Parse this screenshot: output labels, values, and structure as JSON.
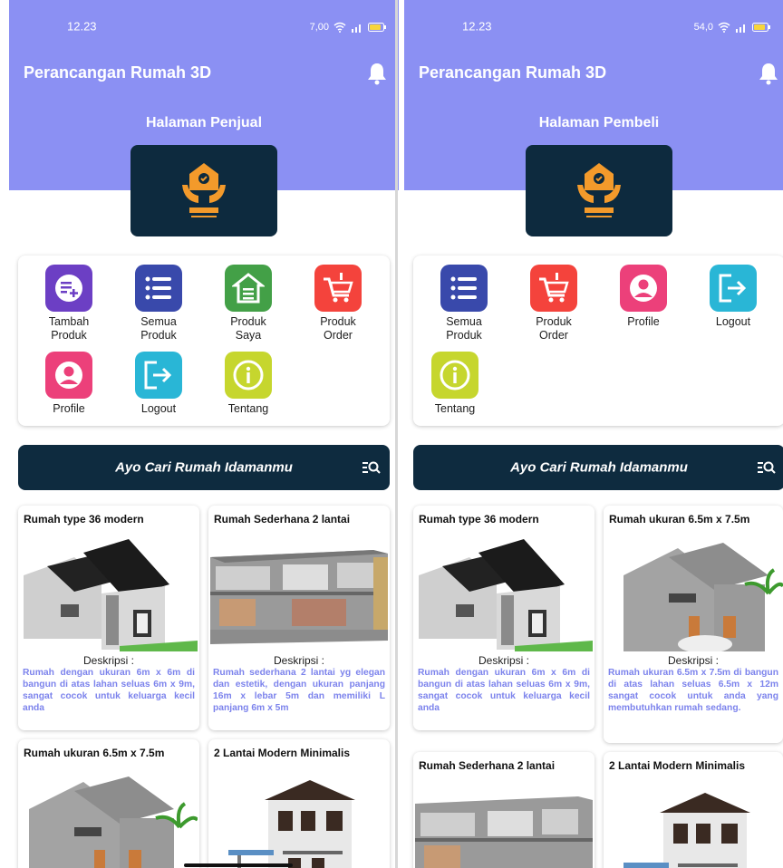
{
  "colors": {
    "header": "#8b90f3",
    "navy": "#0e2b3f",
    "desc_text": "#7c83ec",
    "icon_tambah": "#6c3fc4",
    "icon_semua": "#3949ab",
    "icon_produk_saya": "#43a047",
    "icon_order": "#f4433c",
    "icon_profile": "#ec407a",
    "icon_logout": "#29b6d6",
    "icon_tentang": "#c6d62e"
  },
  "left": {
    "status": {
      "time": "12.23",
      "speed": "7,00"
    },
    "app_title": "Perancangan Rumah 3D",
    "page_title": "Halaman Penjual",
    "menu": [
      {
        "label": "Tambah\nProduk",
        "icon": "add-product-icon"
      },
      {
        "label": "Semua\nProduk",
        "icon": "list-icon"
      },
      {
        "label": "Produk\nSaya",
        "icon": "house-icon"
      },
      {
        "label": "Produk\nOrder",
        "icon": "cart-icon"
      },
      {
        "label": "Profile",
        "icon": "profile-icon"
      },
      {
        "label": "Logout",
        "icon": "logout-icon"
      },
      {
        "label": "Tentang",
        "icon": "info-icon"
      }
    ],
    "search_label": "Ayo Cari Rumah Idamanmu",
    "cards": [
      {
        "title": "Rumah type 36 modern",
        "desc_label": "Deskripsi :",
        "desc": "Rumah dengan ukuran 6m x 6m di bangun di atas lahan seluas 6m x 9m, sangat cocok untuk keluarga kecil anda"
      },
      {
        "title": "Rumah Sederhana 2 lantai",
        "desc_label": "Deskripsi :",
        "desc": "Rumah sederhana 2 lantai yg elegan dan estetik, dengan ukuran panjang 16m x lebar 5m dan memiliki L panjang 6m x 5m"
      },
      {
        "title": "Rumah ukuran 6.5m x 7.5m"
      },
      {
        "title": "2 Lantai Modern Minimalis"
      }
    ]
  },
  "right": {
    "status": {
      "time": "12.23",
      "speed": "54,0"
    },
    "app_title": "Perancangan Rumah 3D",
    "page_title": "Halaman Pembeli",
    "menu": [
      {
        "label": "Semua\nProduk",
        "icon": "list-icon"
      },
      {
        "label": "Produk\nOrder",
        "icon": "cart-icon"
      },
      {
        "label": "Profile",
        "icon": "profile-icon"
      },
      {
        "label": "Logout",
        "icon": "logout-icon"
      },
      {
        "label": "Tentang",
        "icon": "info-icon"
      }
    ],
    "search_label": "Ayo Cari Rumah Idamanmu",
    "cards": [
      {
        "title": "Rumah type 36 modern",
        "desc_label": "Deskripsi :",
        "desc": "Rumah dengan ukuran 6m x 6m di bangun di atas lahan seluas 6m x 9m, sangat cocok untuk keluarga kecil anda"
      },
      {
        "title": "Rumah ukuran 6.5m x 7.5m",
        "desc_label": "Deskripsi :",
        "desc": "Rumah ukuran 6.5m x 7.5m di bangun di atas lahan seluas 6.5m x 12m sangat cocok untuk anda yang membutuhkan rumah sedang."
      },
      {
        "title": "Rumah Sederhana 2 lantai"
      },
      {
        "title": "2 Lantai Modern Minimalis"
      }
    ]
  }
}
